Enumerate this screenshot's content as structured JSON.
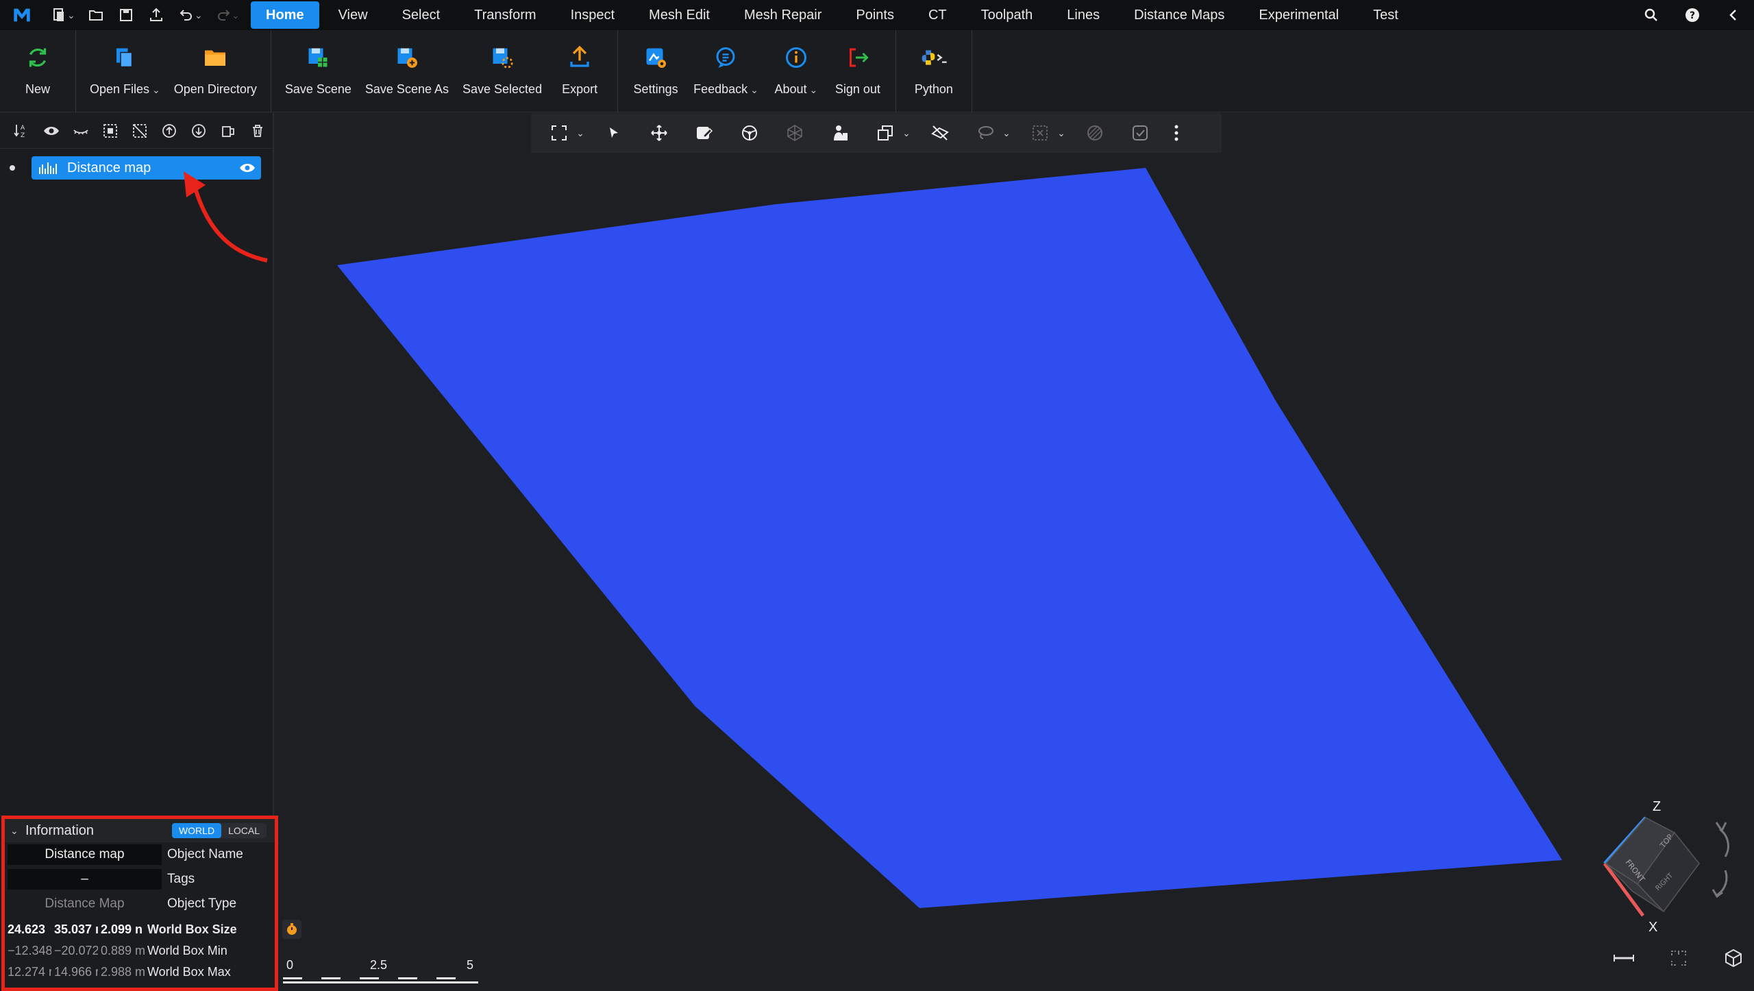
{
  "menubar": {
    "tabs": [
      "Home",
      "View",
      "Select",
      "Transform",
      "Inspect",
      "Mesh Edit",
      "Mesh Repair",
      "Points",
      "CT",
      "Toolpath",
      "Lines",
      "Distance Maps",
      "Experimental",
      "Test"
    ],
    "active_tab": "Home"
  },
  "ribbon": {
    "new": "New",
    "open_files": "Open Files",
    "open_directory": "Open Directory",
    "save_scene": "Save Scene",
    "save_scene_as": "Save Scene As",
    "save_selected": "Save Selected",
    "export": "Export",
    "settings": "Settings",
    "feedback": "Feedback",
    "about": "About",
    "sign_out": "Sign out",
    "python": "Python"
  },
  "scene_tree": {
    "items": [
      {
        "label": "Distance map"
      }
    ]
  },
  "info_panel": {
    "title": "Information",
    "world": "WORLD",
    "local": "LOCAL",
    "object_name_value": "Distance map",
    "object_name_key": "Object Name",
    "tags_value": "–",
    "tags_key": "Tags",
    "object_type_value": "Distance Map",
    "object_type_key": "Object Type",
    "box_size": [
      "24.623",
      "35.037 ı",
      "2.099 n"
    ],
    "box_size_key": "World Box Size",
    "box_min": [
      "−12.348",
      "−20.072",
      "0.889 m"
    ],
    "box_min_key": "World Box Min",
    "box_max": [
      "12.274 r",
      "14.966 r",
      "2.988 m"
    ],
    "box_max_key": "World Box Max"
  },
  "scale_bar": {
    "ticks": [
      "0",
      "2.5",
      "5"
    ]
  },
  "nav_cube": {
    "axis_z": "Z",
    "axis_x": "X",
    "face_top": "TOP",
    "face_front": "FRONT",
    "face_right": "RIGHT"
  },
  "colors": {
    "accent": "#1a8cf0",
    "plane": "#2f4ef0",
    "highlight": "#e8231a"
  }
}
